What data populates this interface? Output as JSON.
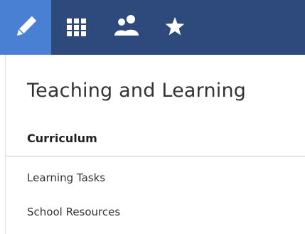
{
  "toolbar": {
    "tabs": [
      {
        "icon": "pencil-icon",
        "active": true
      },
      {
        "icon": "grid-icon",
        "active": false
      },
      {
        "icon": "people-icon",
        "active": false
      },
      {
        "icon": "star-icon",
        "active": false
      }
    ],
    "colors": {
      "bar": "#2e4a7c",
      "active": "#4a80d4",
      "icon": "#ffffff"
    }
  },
  "panel": {
    "title": "Teaching and Learning",
    "section": "Curriculum",
    "links": [
      "Learning Tasks",
      "School Resources"
    ]
  }
}
